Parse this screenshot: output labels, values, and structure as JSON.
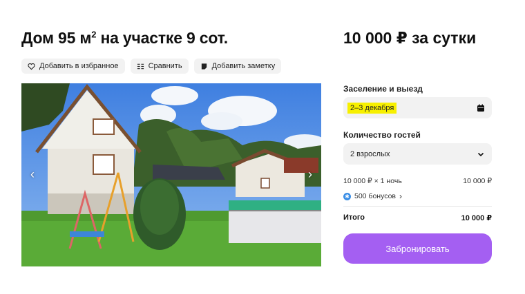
{
  "listing": {
    "title_main": "Дом 95 м",
    "title_sup": "2",
    "title_rest": " на участке 9 сот."
  },
  "actions": {
    "favorite": "Добавить в избранное",
    "compare": "Сравнить",
    "note": "Добавить заметку"
  },
  "photo": {
    "prev_icon": "chevron-left-icon",
    "next_icon": "chevron-right-icon"
  },
  "booking": {
    "price": "10 000 ₽ за сутки",
    "dates_label": "Заселение и выезд",
    "dates_value": "2–3 декабря",
    "guests_label": "Количество гостей",
    "guests_value": "2 взрослых",
    "calc_label": "10 000 ₽ × 1 ночь",
    "calc_value": "10 000 ₽",
    "bonus": "500 бонусов",
    "total_label": "Итого",
    "total_value": "10 000 ₽",
    "book_button": "Забронировать"
  },
  "colors": {
    "accent": "#a45ff2",
    "highlight": "#f7f000",
    "field_bg": "#f2f2f2",
    "bonus_icon": "#3a8ee6"
  }
}
